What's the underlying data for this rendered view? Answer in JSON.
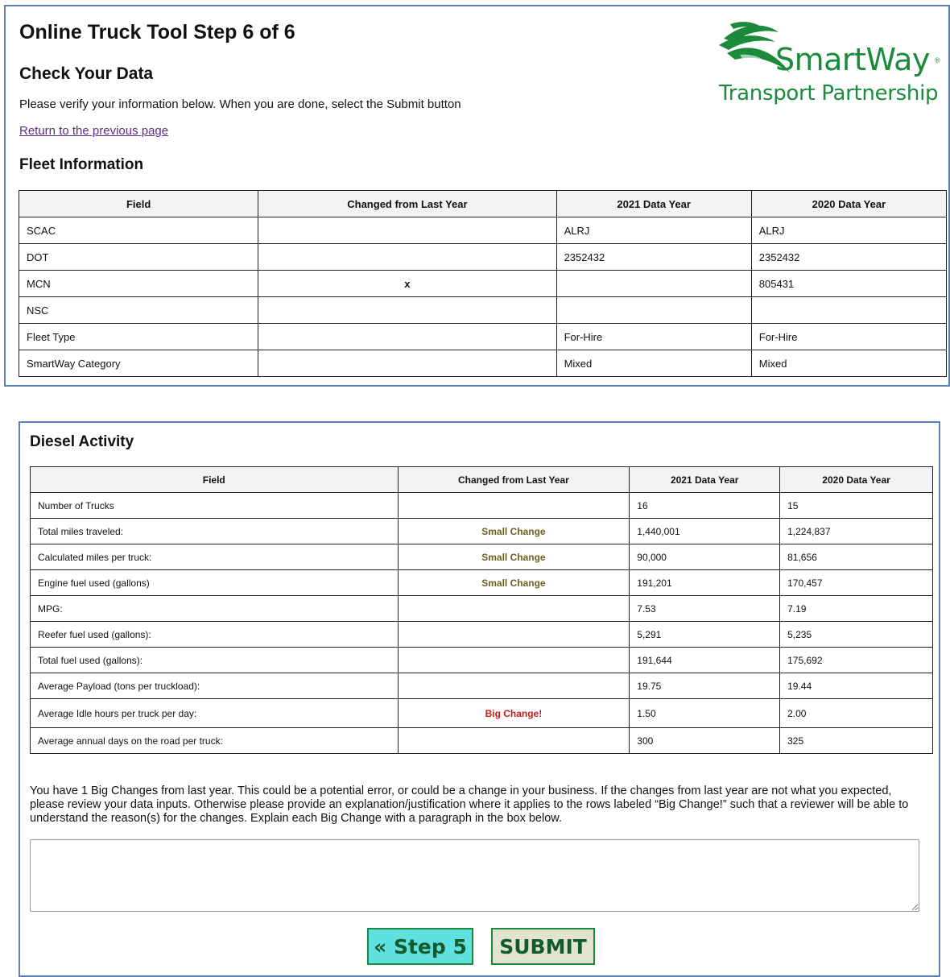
{
  "header": {
    "title": "Online Truck Tool Step 6 of 6",
    "subtitle": "Check Your Data",
    "intro": "Please verify your information below. When you are done, select the Submit button",
    "back_link": "Return to the previous page"
  },
  "logo": {
    "line1": "SmartWay",
    "reg_mark": "®",
    "line2": "Transport Partnership"
  },
  "fleet": {
    "heading": "Fleet Information",
    "columns": [
      "Field",
      "Changed from Last Year",
      "2021 Data Year",
      "2020 Data Year"
    ],
    "rows": [
      {
        "field": "SCAC",
        "changed": "",
        "y2021": "ALRJ",
        "y2020": "ALRJ"
      },
      {
        "field": "DOT",
        "changed": "",
        "y2021": "2352432",
        "y2020": "2352432"
      },
      {
        "field": "MCN",
        "changed": "x",
        "y2021": "",
        "y2020": "805431"
      },
      {
        "field": "NSC",
        "changed": "",
        "y2021": "",
        "y2020": ""
      },
      {
        "field": "Fleet Type",
        "changed": "",
        "y2021": "For-Hire",
        "y2020": "For-Hire"
      },
      {
        "field": "SmartWay Category",
        "changed": "",
        "y2021": "Mixed",
        "y2020": "Mixed"
      }
    ]
  },
  "diesel": {
    "heading": "Diesel Activity",
    "columns": [
      "Field",
      "Changed from Last Year",
      "2021 Data Year",
      "2020 Data Year"
    ],
    "rows": [
      {
        "field": "Number of Trucks",
        "changed": "",
        "y2021": "16",
        "y2020": "15"
      },
      {
        "field": "Total miles traveled:",
        "changed": "Small Change",
        "y2021": "1,440,001",
        "y2020": "1,224,837"
      },
      {
        "field": "Calculated miles per truck:",
        "changed": "Small Change",
        "y2021": "90,000",
        "y2020": "81,656"
      },
      {
        "field": "Engine fuel used (gallons)",
        "changed": "Small Change",
        "y2021": "191,201",
        "y2020": "170,457"
      },
      {
        "field": "MPG:",
        "changed": "",
        "y2021": "7.53",
        "y2020": "7.19"
      },
      {
        "field": "Reefer fuel used (gallons):",
        "changed": "",
        "y2021": "5,291",
        "y2020": "5,235"
      },
      {
        "field": "Total fuel used (gallons):",
        "changed": "",
        "y2021": "191,644",
        "y2020": "175,692"
      },
      {
        "field": "Average Payload (tons per truckload):",
        "changed": "",
        "y2021": "19.75",
        "y2020": "19.44"
      },
      {
        "field": "Average Idle hours per truck per day:",
        "changed": "Big Change!",
        "y2021": "1.50",
        "y2020": "2.00"
      },
      {
        "field": "Average annual days on the road per truck:",
        "changed": "",
        "y2021": "300",
        "y2020": "325"
      }
    ],
    "explanation": "You have 1 Big Changes from last year. This could be a potential error, or could be a change in your business. If the changes from last year are not what you expected, please review your data inputs. Otherwise please provide an explanation/justification where it applies to the rows labeled “Big Change!” such that a reviewer will be able to understand the reason(s) for the changes. Explain each Big Change with a paragraph in the box below.",
    "textbox_value": ""
  },
  "buttons": {
    "prev_label": "« Step 5",
    "submit_label": "SUBMIT"
  },
  "colors": {
    "panel_border": "#5b7fb5",
    "brand_green": "#1b8a3b",
    "small_change": "#6b6023",
    "big_change": "#c21a1a",
    "prev_button_bg": "#5fe2df",
    "submit_button_bg": "#e3e3d2"
  }
}
